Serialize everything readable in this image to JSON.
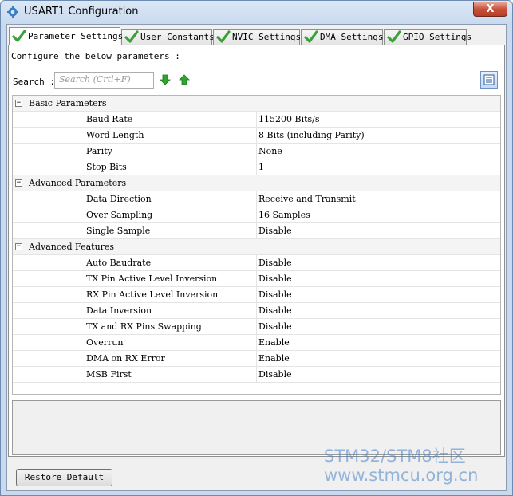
{
  "window": {
    "title": "USART1 Configuration",
    "close_label": "X"
  },
  "tabs": [
    {
      "label": "Parameter Settings",
      "active": true
    },
    {
      "label": "User Constants",
      "active": false
    },
    {
      "label": "NVIC Settings",
      "active": false
    },
    {
      "label": "DMA Settings",
      "active": false
    },
    {
      "label": "GPIO Settings",
      "active": false
    }
  ],
  "panel": {
    "configure_text": "Configure the below parameters :",
    "search_label": "Search :",
    "search_placeholder": "Search (Crtl+F)"
  },
  "groups": [
    {
      "name": "Basic Parameters",
      "expander": "−",
      "params": [
        {
          "name": "Baud Rate",
          "value": "115200 Bits/s"
        },
        {
          "name": "Word Length",
          "value": "8 Bits (including Parity)"
        },
        {
          "name": "Parity",
          "value": "None"
        },
        {
          "name": "Stop Bits",
          "value": "1"
        }
      ]
    },
    {
      "name": "Advanced Parameters",
      "expander": "−",
      "params": [
        {
          "name": "Data Direction",
          "value": "Receive and Transmit"
        },
        {
          "name": "Over Sampling",
          "value": "16 Samples"
        },
        {
          "name": "Single Sample",
          "value": "Disable"
        }
      ]
    },
    {
      "name": "Advanced Features",
      "expander": "−",
      "params": [
        {
          "name": "Auto Baudrate",
          "value": "Disable"
        },
        {
          "name": "TX Pin Active Level Inversion",
          "value": "Disable"
        },
        {
          "name": "RX Pin Active Level Inversion",
          "value": "Disable"
        },
        {
          "name": "Data Inversion",
          "value": "Disable"
        },
        {
          "name": "TX and RX Pins Swapping",
          "value": "Disable"
        },
        {
          "name": "Overrun",
          "value": "Enable"
        },
        {
          "name": "DMA on RX Error",
          "value": "Enable"
        },
        {
          "name": "MSB First",
          "value": "Disable"
        }
      ]
    }
  ],
  "footer": {
    "restore_label": "Restore Default"
  },
  "watermark": {
    "line1": "STM32/STM8社区",
    "line2": "www.stmcu.org.cn"
  },
  "colors": {
    "check_green": "#3aa13a",
    "arrow_green": "#2fa52f",
    "close_red": "#c7513b"
  },
  "icons": {
    "title": "gear-icon",
    "tab_status": "checkmark-icon",
    "search_next": "arrow-down-icon",
    "search_prev": "arrow-up-icon",
    "view_toggle": "list-view-icon"
  }
}
